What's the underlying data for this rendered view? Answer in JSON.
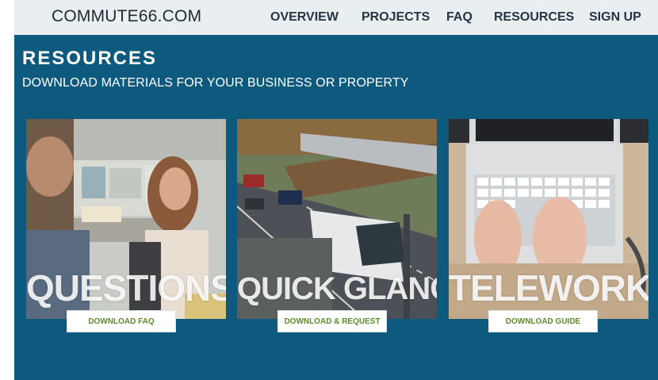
{
  "header": {
    "brand": "COMMUTE66.COM",
    "nav": [
      "OVERVIEW",
      "PROJECTS",
      "FAQ",
      "RESOURCES",
      "SIGN UP"
    ]
  },
  "hero": {
    "title": "RESOURCES",
    "subtitle": "DOWNLOAD MATERIALS FOR YOUR BUSINESS OR PROPERTY"
  },
  "cards": [
    {
      "label": "QUESTIONS",
      "button": "DOWNLOAD FAQ"
    },
    {
      "label": "QUICK GLANCE",
      "button": "DOWNLOAD & REQUEST"
    },
    {
      "label": "TELEWORK",
      "button": "DOWNLOAD GUIDE"
    }
  ],
  "colors": {
    "hero_background": "#0e5a7e",
    "nav_background": "#e9eef1",
    "button_text": "#5c8a2d"
  }
}
